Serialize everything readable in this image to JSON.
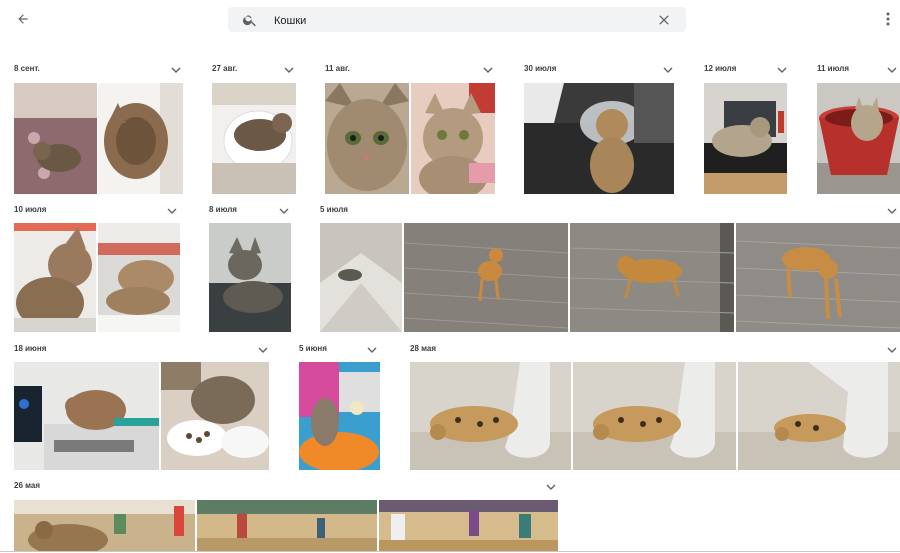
{
  "search": {
    "query": "Кошки"
  },
  "groups": [
    {
      "id": "g1",
      "date": "8 сент."
    },
    {
      "id": "g2",
      "date": "27 авг."
    },
    {
      "id": "g3",
      "date": "11 авг."
    },
    {
      "id": "g4",
      "date": "30 июля"
    },
    {
      "id": "g5",
      "date": "12 июля"
    },
    {
      "id": "g6",
      "date": "11 июля"
    },
    {
      "id": "g7",
      "date": "10 июля"
    },
    {
      "id": "g8",
      "date": "8 июля"
    },
    {
      "id": "g9",
      "date": "5 июля"
    },
    {
      "id": "g10",
      "date": "18 июня"
    },
    {
      "id": "g11",
      "date": "5 июня"
    },
    {
      "id": "g12",
      "date": "28 мая"
    },
    {
      "id": "g13",
      "date": "26 мая"
    }
  ],
  "icons": {
    "back": "arrow-left-icon",
    "search": "search-icon",
    "clear": "close-icon",
    "more": "more-vert-icon",
    "expand": "chevron-down-icon"
  },
  "colors": {
    "search_bg": "#f1f3f4",
    "text": "#3c4043",
    "icon": "#5f6368"
  }
}
